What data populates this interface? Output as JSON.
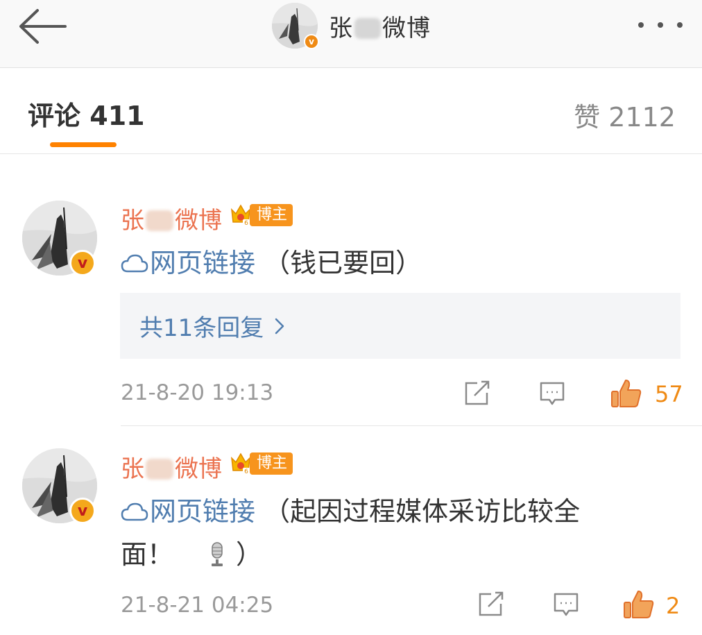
{
  "header": {
    "name_prefix": "张",
    "name_suffix": "微博",
    "badge": "v"
  },
  "tabs": {
    "comments_label": "评论",
    "comments_count": "411",
    "likes_label": "赞",
    "likes_count": "2112"
  },
  "comments": [
    {
      "name_prefix": "张",
      "name_suffix": "微博",
      "tag": "博主",
      "badge": "v",
      "link_text": "网页链接",
      "text_line1": "（钱已要回）",
      "text_line2": "",
      "replies_label": "共11条回复",
      "time": "21-8-20 19:13",
      "likes": "57"
    },
    {
      "name_prefix": "张",
      "name_suffix": "微博",
      "tag": "博主",
      "badge": "v",
      "link_text": "网页链接",
      "text_line1": "（起因过程媒体采访比较全",
      "text_line2": "面！",
      "text_line2_end": "）",
      "emoji": "microphone-icon",
      "time": "21-8-21 04:25",
      "likes": "2"
    }
  ],
  "colors": {
    "accent": "#ff8200",
    "link": "#507daf",
    "name": "#eb7350",
    "like": "#ef8a14"
  }
}
